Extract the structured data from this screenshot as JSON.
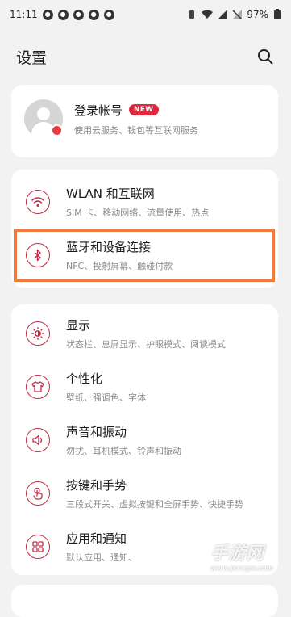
{
  "status_bar": {
    "time": "11:11",
    "battery": "97%"
  },
  "header": {
    "title": "设置"
  },
  "account": {
    "title": "登录帐号",
    "badge": "NEW",
    "subtitle": "使用云服务、钱包等互联网服务"
  },
  "menu": {
    "wlan": {
      "title": "WLAN 和互联网",
      "subtitle": "SIM 卡、移动网络、流量使用、热点"
    },
    "bluetooth": {
      "title": "蓝牙和设备连接",
      "subtitle": "NFC、投射屏幕、触碰付款"
    },
    "display": {
      "title": "显示",
      "subtitle": "状态栏、息屏显示、护眼模式、阅读模式"
    },
    "personalize": {
      "title": "个性化",
      "subtitle": "壁纸、强调色、字体"
    },
    "sound": {
      "title": "声音和振动",
      "subtitle": "勿扰、耳机模式、铃声和振动"
    },
    "buttons": {
      "title": "按键和手势",
      "subtitle": "三段式开关、虚拟按键和全屏手势、快捷手势"
    },
    "apps": {
      "title": "应用和通知",
      "subtitle": "默认应用、通知、"
    }
  },
  "icons": {
    "search": "search-icon",
    "wifi": "wifi-icon",
    "bluetooth": "bluetooth-icon",
    "display": "brightness-icon",
    "personalize": "tshirt-icon",
    "sound": "speaker-icon",
    "buttons": "gesture-icon",
    "apps": "apps-grid-icon"
  },
  "colors": {
    "accent": "#c32b42",
    "badge": "#e0283a",
    "highlight": "#f47a3c"
  },
  "watermark": {
    "text": "手游网",
    "url": "www.jsrwgw.com"
  }
}
